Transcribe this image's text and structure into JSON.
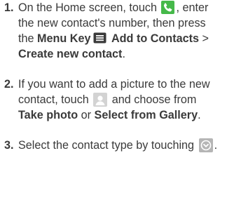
{
  "steps": [
    {
      "number": "1.",
      "text_1": "On the Home screen, touch",
      "text_2": ", enter the new contact's number, then press the",
      "menu_key": "Menu Key",
      "add_to_contacts": "Add to Contacts",
      "separator": " > ",
      "create_new_contact": "Create new contact",
      "end": ".",
      "icons": [
        "phone-icon",
        "menu-icon"
      ]
    },
    {
      "number": "2.",
      "text_1": "If you want to add a picture to the new contact, touch",
      "text_2": " and choose from",
      "take_photo": "Take photo",
      "or": " or ",
      "select_from_gallery": "Select from Gallery",
      "end": ".",
      "icons": [
        "contact-picture-icon"
      ]
    },
    {
      "number": "3.",
      "text_1": "Select the contact type by touching",
      "end": ".",
      "icons": [
        "chevron-down-icon"
      ]
    }
  ],
  "colors": {
    "text": "#3a3a3a",
    "phone_icon_bg": "#46b94a",
    "contact_icon_bg": "#d3d3d3",
    "chevron_icon_bg": "#b5b5b5"
  }
}
